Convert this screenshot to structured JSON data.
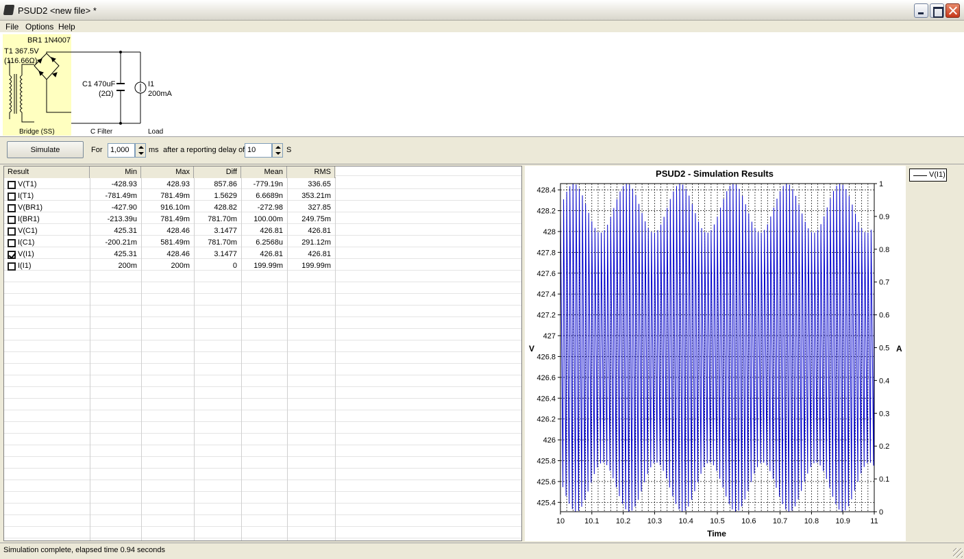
{
  "window": {
    "title": "PSUD2  <new file> *"
  },
  "menu": {
    "items": [
      "File",
      "Options",
      "Help"
    ]
  },
  "schematic": {
    "bridge_label": "BR1 1N4007",
    "transformer_voltage": "T1 367.5V",
    "transformer_resistance": "(116.66Ω)",
    "cap_value": "C1 470uF",
    "cap_resistance": "(2Ω)",
    "load_name": "I1",
    "load_value": "200mA",
    "section_bridge": "Bridge (SS)",
    "section_filter": "C Filter",
    "section_load": "Load"
  },
  "simbar": {
    "simulate_label": "Simulate",
    "for_label": "For",
    "duration_value": "1,000",
    "duration_unit": "ms",
    "delay_label": "after a reporting delay of",
    "delay_value": "10",
    "delay_unit": "S"
  },
  "results": {
    "columns": [
      "Result",
      "Min",
      "Max",
      "Diff",
      "Mean",
      "RMS"
    ],
    "rows": [
      {
        "name": "V(T1)",
        "checked": false,
        "min": "-428.93",
        "max": "428.93",
        "diff": "857.86",
        "mean": "-779.19n",
        "rms": "336.65"
      },
      {
        "name": "I(T1)",
        "checked": false,
        "min": "-781.49m",
        "max": "781.49m",
        "diff": "1.5629",
        "mean": "6.6689n",
        "rms": "353.21m"
      },
      {
        "name": "V(BR1)",
        "checked": false,
        "min": "-427.90",
        "max": "916.10m",
        "diff": "428.82",
        "mean": "-272.98",
        "rms": "327.85"
      },
      {
        "name": "I(BR1)",
        "checked": false,
        "min": "-213.39u",
        "max": "781.49m",
        "diff": "781.70m",
        "mean": "100.00m",
        "rms": "249.75m"
      },
      {
        "name": "V(C1)",
        "checked": false,
        "min": "425.31",
        "max": "428.46",
        "diff": "3.1477",
        "mean": "426.81",
        "rms": "426.81"
      },
      {
        "name": "I(C1)",
        "checked": false,
        "min": "-200.21m",
        "max": "581.49m",
        "diff": "781.70m",
        "mean": "6.2568u",
        "rms": "291.12m"
      },
      {
        "name": "V(I1)",
        "checked": true,
        "min": "425.31",
        "max": "428.46",
        "diff": "3.1477",
        "mean": "426.81",
        "rms": "426.81"
      },
      {
        "name": "I(I1)",
        "checked": false,
        "min": "200m",
        "max": "200m",
        "diff": "0",
        "mean": "199.99m",
        "rms": "199.99m"
      }
    ]
  },
  "chart_data": {
    "type": "line",
    "title": "PSUD2 - Simulation Results",
    "xlabel": "Time",
    "ylabel": "V",
    "y2label": "A",
    "xlim": [
      10,
      11
    ],
    "ylim": [
      425.31,
      428.46
    ],
    "y2lim": [
      0,
      1
    ],
    "xticks": [
      "10",
      "10.1",
      "10.2",
      "10.3",
      "10.4",
      "10.5",
      "10.6",
      "10.7",
      "10.8",
      "10.9",
      "11"
    ],
    "yticks": [
      "425.4",
      "425.6",
      "425.8",
      "426",
      "426.2",
      "426.4",
      "426.6",
      "426.8",
      "427",
      "427.2",
      "427.4",
      "427.6",
      "427.8",
      "428",
      "428.2",
      "428.4"
    ],
    "y2ticks": [
      "0",
      "0.1",
      "0.2",
      "0.3",
      "0.4",
      "0.5",
      "0.6",
      "0.7",
      "0.8",
      "0.9",
      "1"
    ],
    "grid": true,
    "legend": "top-right",
    "series": [
      {
        "name": "V(I1)",
        "color": "#0000cc",
        "min": 425.31,
        "max": 428.46,
        "ripple_hz": 100
      }
    ]
  },
  "legend": {
    "label": "V(I1)"
  },
  "status": {
    "text": "Simulation complete, elapsed time 0.94 seconds"
  }
}
